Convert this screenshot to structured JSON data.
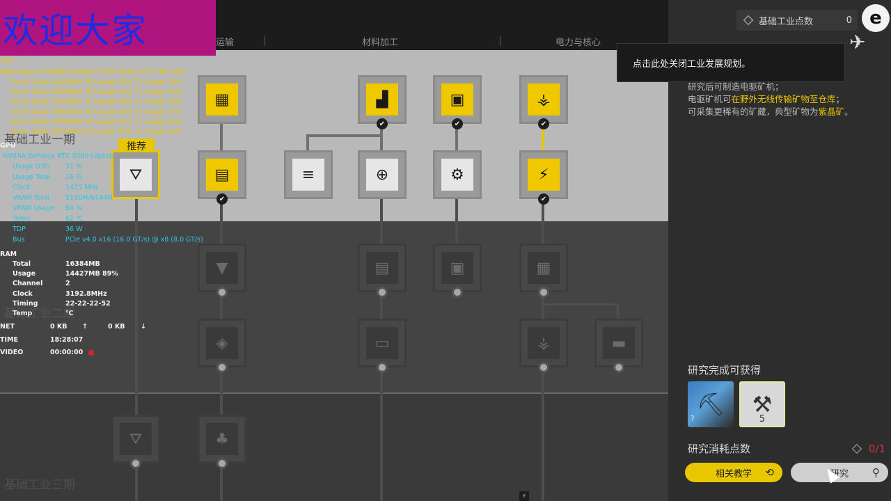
{
  "tabs": [
    "运输",
    "材料加工",
    "电力与核心"
  ],
  "phases": [
    "基础工业一期",
    "基础工业二期",
    "基础工业三期"
  ],
  "recommend_label": "推荐",
  "tooltip": "点击此处关闭工业发展规划。",
  "points": {
    "label": "基础工业点数",
    "value": "0"
  },
  "description": {
    "l1": "研究后可制造电驱矿机；",
    "l2a": "电驱矿机可",
    "l2b": "在野外无线传输矿物至仓库",
    "l2c": "；",
    "l3a": "可采集更稀有的矿藏，典型矿物为",
    "l3b": "紫晶矿",
    "l3c": "。"
  },
  "reward": {
    "title": "研究完成可获得",
    "qty": "5"
  },
  "cost": {
    "label": "研究消耗点数",
    "value": "0/1"
  },
  "buttons": {
    "tutorial": "相关教学",
    "research": "研究"
  },
  "banner": "欢迎大家",
  "hw": {
    "cpu_title": "CPU",
    "cpu_line": "AMD Ryzen 5 5600H    Voltage  1.28V    Temp  77℃    TDP  32W",
    "cores": [
      "Core0    Clock  4043MHz     T0 Usage  38%      T1 Usage  29%",
      "Core1    Clock  3993MHz     T0 Usage  54%      T1 Usage  32%",
      "Core2    Clock  3993MHz     T0 Usage  44%      T1 Usage  30%",
      "Core3    Clock  3993MHz     T0 Usage  44%      T1 Usage  27%",
      "Core4    Clock  3993MHz     T0 Usage  44%      T1 Usage  25%",
      "Core5    Clock  3993MHz     T0 Usage  46%      T1 Usage  21%"
    ],
    "gpu_title": "GPU",
    "gpu_name": "NVIDIA GeForce RTX 3060 Laptop",
    "gpu_rows": [
      [
        "Usage D3D",
        "31 %"
      ],
      [
        "Usage Total",
        "16 %"
      ],
      [
        "Clock",
        "1425 MHz"
      ],
      [
        "VRAM Total",
        "5160M/6144M"
      ],
      [
        "VRAM Usage",
        "84 %"
      ],
      [
        "Temp",
        "62 ℃"
      ],
      [
        "TDP",
        "36 W"
      ],
      [
        "Bus",
        "PCIe v4.0 x16 (16.0 GT/s) @ x8 (8.0 GT/s)"
      ]
    ],
    "ram_title": "RAM",
    "ram_rows": [
      [
        "Total",
        "16384MB"
      ],
      [
        "Usage",
        "14427MB     89%"
      ],
      [
        "Channel",
        "2"
      ],
      [
        "Clock",
        "3192.8MHz"
      ],
      [
        "Timing",
        "22-22-22-52"
      ],
      [
        "Temp",
        "℃"
      ]
    ],
    "net": [
      "NET",
      "0 KB",
      "↑",
      "0 KB",
      "↓"
    ],
    "time": [
      "TIME",
      "18:28:07"
    ],
    "video": [
      "VIDEO",
      "00:00:00"
    ]
  }
}
